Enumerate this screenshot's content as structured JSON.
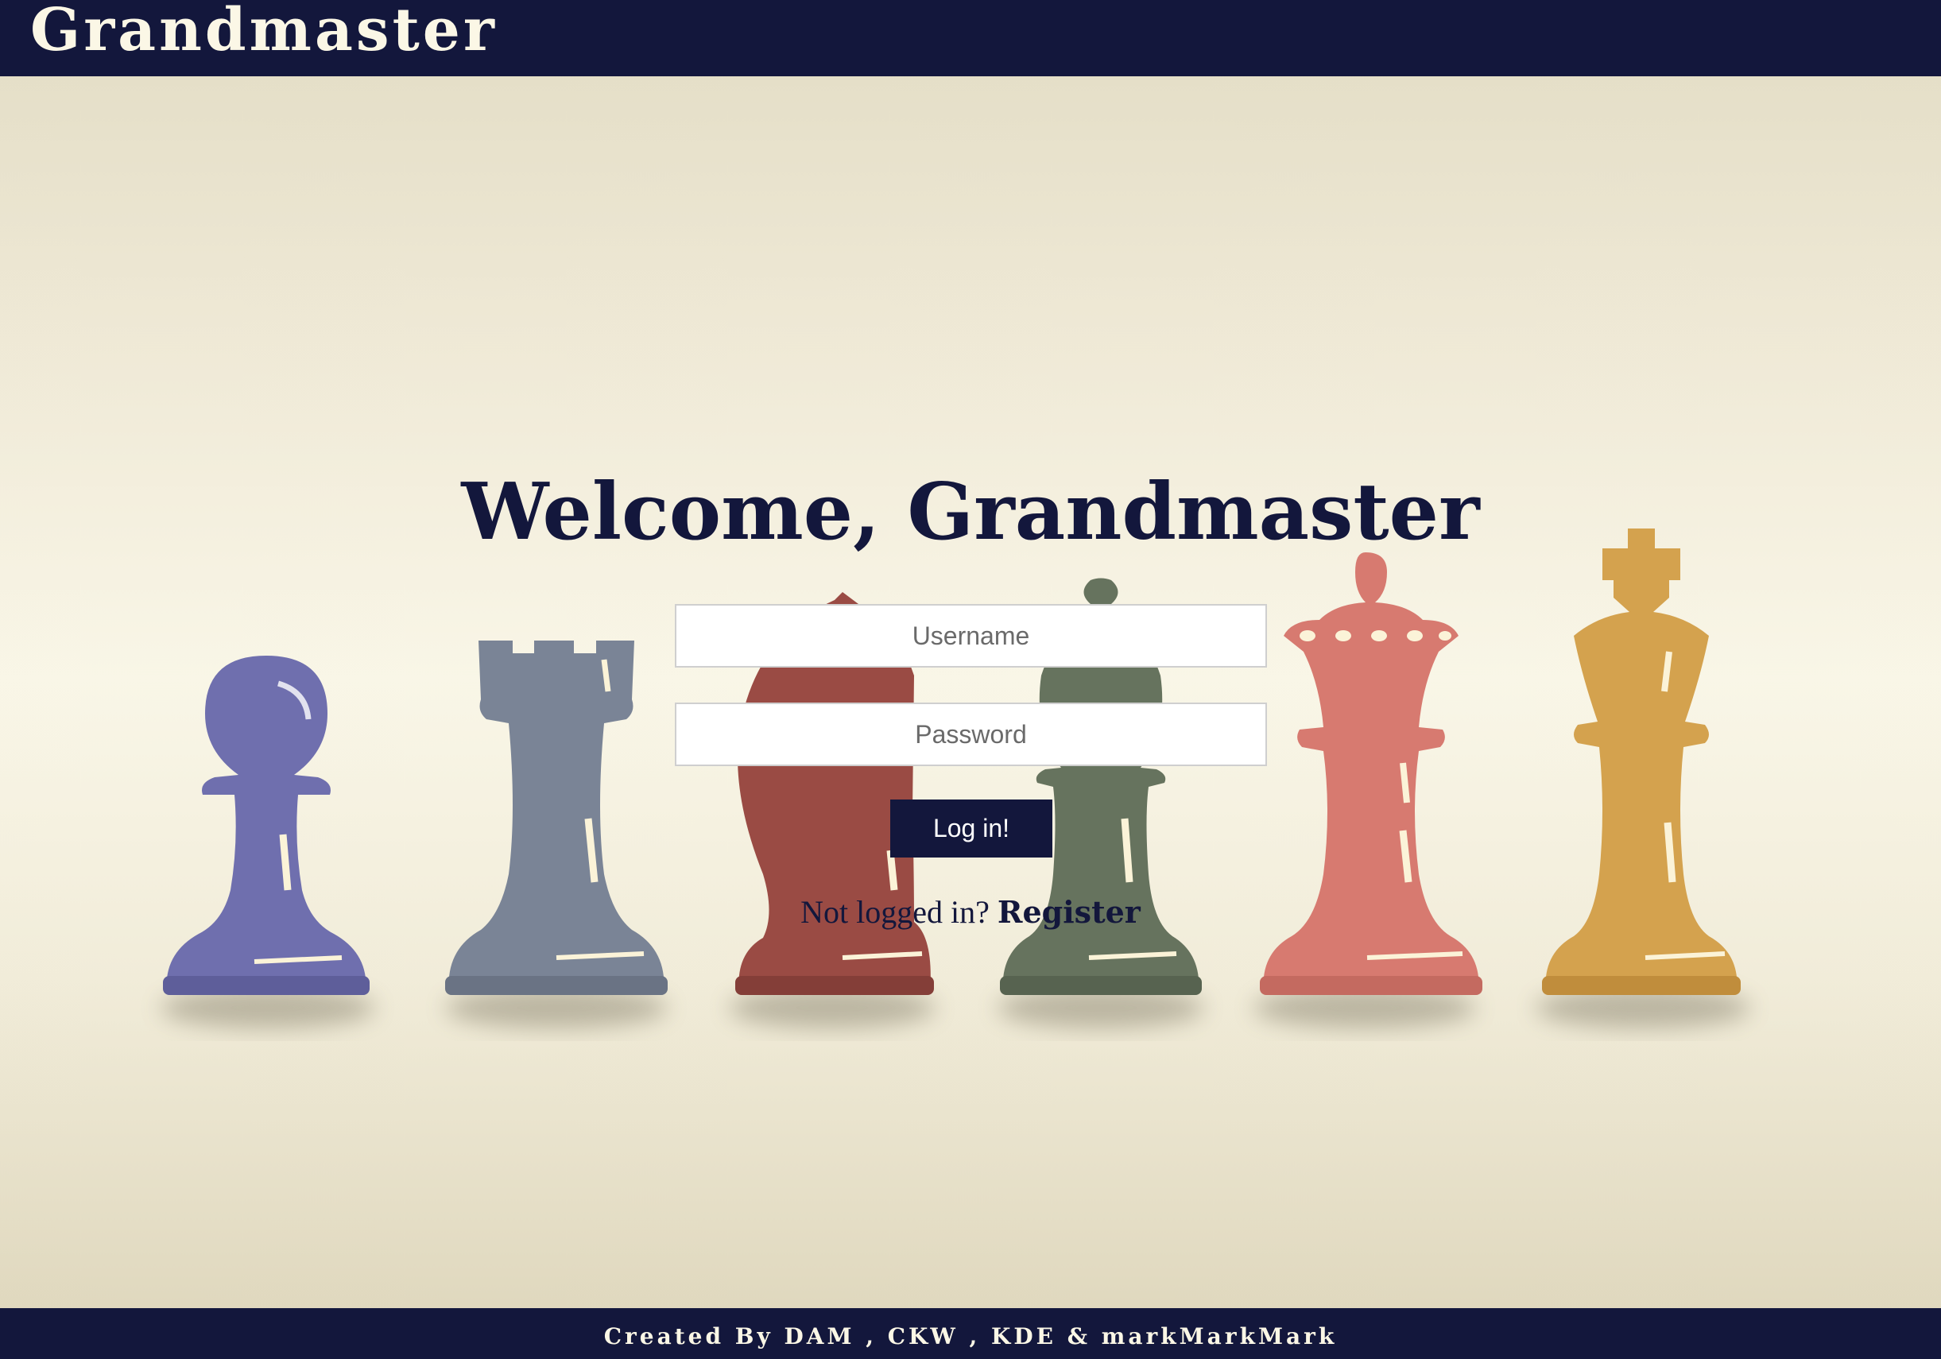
{
  "header": {
    "brand": "Grandmaster"
  },
  "background": {
    "pieces": [
      {
        "icon": "pawn-icon",
        "color": "#6f6fae"
      },
      {
        "icon": "rook-icon",
        "color": "#7a8496"
      },
      {
        "icon": "knight-icon",
        "color": "#9a4b44"
      },
      {
        "icon": "bishop-icon",
        "color": "#66735e"
      },
      {
        "icon": "queen-icon",
        "color": "#d77a70"
      },
      {
        "icon": "king-icon",
        "color": "#d4a24e"
      }
    ]
  },
  "login": {
    "title": "Welcome, Grandmaster",
    "username_placeholder": "Username",
    "password_placeholder": "Password",
    "submit_label": "Log in!",
    "prompt": "Not logged in?",
    "register_label": "Register"
  },
  "footer": {
    "credits": "Created By DAM , CKW , KDE & markMarkMark"
  },
  "colors": {
    "primary": "#13173c",
    "text_light": "#fbf7e6"
  }
}
